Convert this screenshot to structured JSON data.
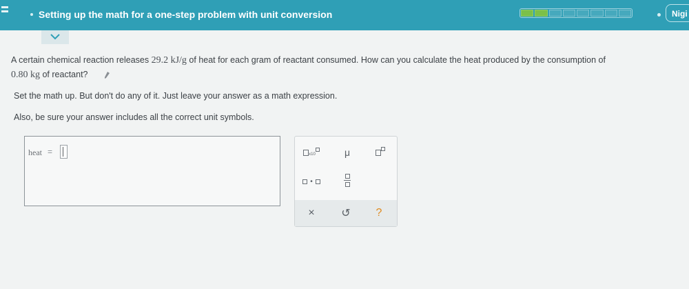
{
  "header": {
    "title": "Setting up the math for a one-step problem with unit conversion",
    "progress": {
      "segments": 8,
      "completed": 2
    },
    "user_name": "Nigi",
    "menu_icon": "hamburger-icon",
    "collapse_icon": "chevron-down-icon"
  },
  "question": {
    "part1": "A certain chemical reaction releases",
    "value1": "29.2 kJ/g",
    "part2": "of heat for each gram of reactant consumed. How can you calculate the heat produced by the consumption of",
    "value2": "0.80 kg",
    "part3": "of reactant?",
    "instruction1": "Set the math up. But don't do any of it. Just leave your answer as a math expression.",
    "instruction2": "Also, be sure your answer includes all the correct unit symbols."
  },
  "answer": {
    "label": "heat",
    "equals": "="
  },
  "palette": {
    "sci_notation_label": "x10",
    "mu_symbol": "μ",
    "clear_symbol": "×",
    "undo_symbol": "↺",
    "help_symbol": "?"
  },
  "colors": {
    "header_bg": "#2f9fb6",
    "progress_done": "#7bc04a",
    "help_accent": "#e08a1e"
  }
}
